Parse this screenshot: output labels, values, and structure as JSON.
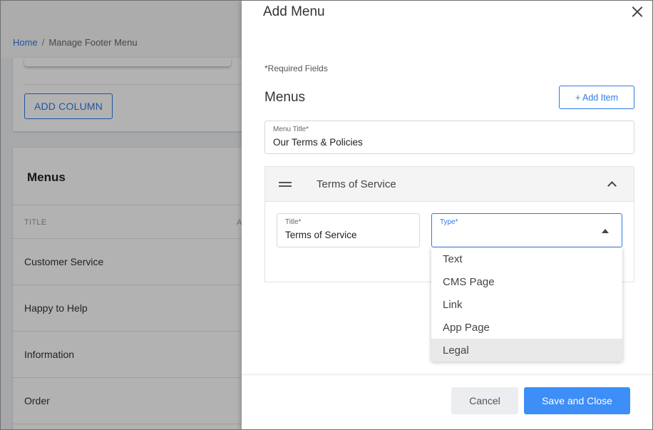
{
  "background": {
    "breadcrumb": {
      "home": "Home",
      "separator": "/",
      "current": "Manage Footer Menu"
    },
    "add_column_label": "ADD COLUMN",
    "menus_card": {
      "title": "Menus",
      "columns": [
        "TITLE",
        "A"
      ],
      "rows": [
        "Customer Service",
        "Happy to Help",
        "Information",
        "Order"
      ]
    }
  },
  "drawer": {
    "title": "Add Menu",
    "required_note": "*Required Fields",
    "section_title": "Menus",
    "add_item_label": "+ Add Item",
    "menu_title_field": {
      "label": "Menu Title*",
      "value": "Our Terms & Policies"
    },
    "item": {
      "header_title": "Terms of Service",
      "title_field": {
        "label": "Title*",
        "value": "Terms of Service"
      },
      "type_field": {
        "label": "Type*",
        "value": ""
      }
    },
    "type_options": [
      "Text",
      "CMS Page",
      "Link",
      "App Page",
      "Legal"
    ],
    "highlighted_option": "Legal",
    "cancel_label": "Cancel",
    "save_label": "Save and Close"
  },
  "colors": {
    "accent": "#2d7be5",
    "primary_button": "#3d8ef7",
    "overlay": "rgba(0,0,0,0.30)"
  }
}
